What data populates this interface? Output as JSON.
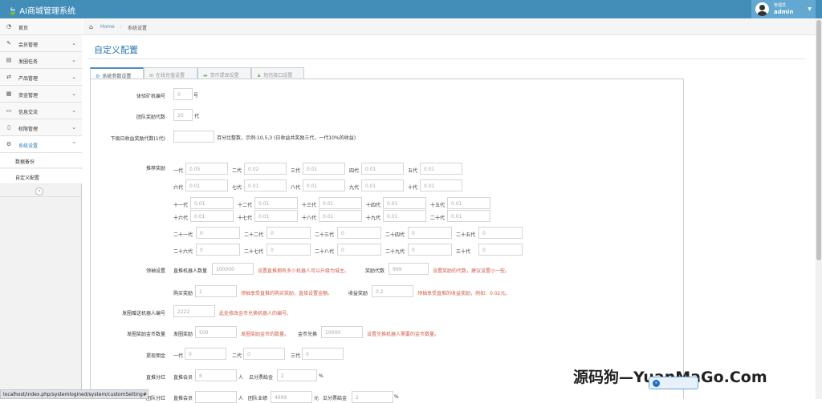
{
  "app": {
    "title": "AI商城管理系统"
  },
  "user": {
    "role": "管理员",
    "name": "admin"
  },
  "sidebar": {
    "items": [
      {
        "label": "首页",
        "icon": "tachometer-icon"
      },
      {
        "label": "会员管理",
        "icon": "edit-icon"
      },
      {
        "label": "发圈任务",
        "icon": "list-alt-icon"
      },
      {
        "label": "产品管理",
        "icon": "random-icon"
      },
      {
        "label": "资金管理",
        "icon": "calendar-icon"
      },
      {
        "label": "信息交流",
        "icon": "comment-icon"
      },
      {
        "label": "权限管理",
        "icon": "file-icon"
      },
      {
        "label": "系统设置",
        "icon": "gears-icon"
      }
    ],
    "subitems": [
      "数据备份",
      "自定义配置"
    ]
  },
  "breadcrumb": {
    "home": "Home",
    "current": "系统设置"
  },
  "page": {
    "title": "自定义配置"
  },
  "tabs": [
    {
      "label": "系统参数设置",
      "active": true
    },
    {
      "label": "在线充值设置",
      "active": false
    },
    {
      "label": "货币提现设置",
      "active": false
    },
    {
      "label": "短信接口设置",
      "active": false
    }
  ],
  "form": {
    "trial": {
      "label": "体验矿机编号",
      "value": "0",
      "unit": "号"
    },
    "team": {
      "label": "团队奖励代数",
      "value": "20",
      "unit": "代"
    },
    "sub": {
      "label": "下级日收益奖励代数(1代)",
      "value": "",
      "hint": "百分比整数，示例:10,5,3 (日收益共奖励三代，一代10%的收益)"
    },
    "recommend": {
      "label": "推荐奖励",
      "row1": [
        {
          "gen": "一代",
          "value": "0.05"
        },
        {
          "gen": "二代",
          "value": "0.02"
        },
        {
          "gen": "三代",
          "value": "0.01"
        },
        {
          "gen": "四代",
          "value": "0.01"
        },
        {
          "gen": "五代",
          "value": "0.01"
        }
      ],
      "row2": [
        {
          "gen": "六代",
          "value": "0.01"
        },
        {
          "gen": "七代",
          "value": "0.01"
        },
        {
          "gen": "八代",
          "value": "0.01"
        },
        {
          "gen": "九代",
          "value": "0.01"
        },
        {
          "gen": "十代",
          "value": "0.01"
        }
      ],
      "row3": [
        {
          "gen": "十一代",
          "value": "0.01"
        },
        {
          "gen": "十二代",
          "value": "0.01"
        },
        {
          "gen": "十三代",
          "value": "0.01"
        },
        {
          "gen": "十四代",
          "value": "0.01"
        },
        {
          "gen": "十五代",
          "value": "0.01"
        }
      ],
      "row4": [
        {
          "gen": "十六代",
          "value": "0.01"
        },
        {
          "gen": "十七代",
          "value": "0.01"
        },
        {
          "gen": "十八代",
          "value": "0.01"
        },
        {
          "gen": "十九代",
          "value": "0.01"
        },
        {
          "gen": "二十代",
          "value": "0.01"
        }
      ],
      "row5": [
        {
          "gen": "二十一代",
          "value": "0"
        },
        {
          "gen": "二十二代",
          "value": "0"
        },
        {
          "gen": "二十三代",
          "value": "0"
        },
        {
          "gen": "二十四代",
          "value": "0"
        },
        {
          "gen": "二十五代",
          "value": "0"
        }
      ],
      "row6": [
        {
          "gen": "二十六代",
          "value": "0"
        },
        {
          "gen": "二十七代",
          "value": "0"
        },
        {
          "gen": "二十八代",
          "value": "0"
        },
        {
          "gen": "二十九代",
          "value": "0"
        },
        {
          "gen": "三十代",
          "value": "0"
        }
      ]
    },
    "leader": {
      "label": "领袖设置",
      "robots_label": "直推机器人数量",
      "robots_value": "100000",
      "robots_hint": "设置直推拥有多少机器人可以升级为城主。",
      "gens_label": "奖励代数",
      "gens_value": "999",
      "gens_hint": "设置奖励的代数，建议设置小一些。",
      "buy_label": "购买奖励",
      "buy_value": "1",
      "buy_hint": "领袖享受直推的购买奖励，直接设置金额。",
      "income_label": "收益奖励",
      "income_value": "0.2",
      "income_hint": "领袖享受直推的收益奖励，例如：0.02元。"
    },
    "gift": {
      "label": "发圈赠送机器人编号",
      "value": "2222",
      "hint": "此处修改金币兑换机器人的编号。"
    },
    "coins": {
      "label": "发圈奖励金币数量",
      "reward_label": "发圈奖励",
      "reward_value": "500",
      "reward_hint": "发圈奖励金币的数量。",
      "exchange_label": "金币兑换",
      "exchange_value": "10000",
      "exchange_hint": "设置兑换机器人需要的金币数量。"
    },
    "commission": {
      "label": "提现佣金",
      "items": [
        {
          "gen": "一代",
          "value": "0"
        },
        {
          "gen": "二代",
          "value": "0"
        },
        {
          "gen": "三代",
          "value": "0"
        }
      ]
    },
    "dividend": {
      "label": "直推分红",
      "member_label": "直推会员",
      "member_value": "6",
      "member_unit": "人",
      "share_label": "瓜分票給金",
      "share_value": "2",
      "share_unit": "%"
    },
    "team_div": {
      "label": "团队分红",
      "member_label": "直推会员",
      "member_value": "",
      "member_unit": "人",
      "perf_label": "团队业绩",
      "perf_value": "4999",
      "perf_unit": "元",
      "share_label": "瓜分票給金",
      "share_value": "2",
      "share_unit": "%"
    }
  },
  "status_url": "localhost/index.php/systemlogined/system/customSetting#",
  "watermark": {
    "cn": "源码狗",
    "sep": "—",
    "en": "YuanMaGo.Com"
  }
}
